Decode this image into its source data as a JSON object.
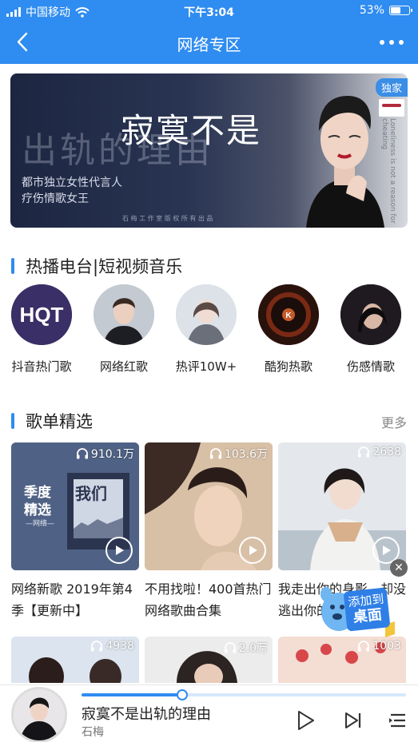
{
  "status_bar": {
    "carrier": "中国移动",
    "time": "下午3:04",
    "battery": "53%",
    "battery_level": 0.53
  },
  "header": {
    "title": "网络专区"
  },
  "banner": {
    "background_title": "出轨的理由",
    "title": "寂寞不是",
    "subtitle_1": "都市独立女性代言人",
    "subtitle_2": "疗伤情歌女王",
    "credit": "石 梅 工 作 室 版 权 所 有 出 品",
    "side_text": "Loneliness is not a reason for cheating",
    "badge": "独家"
  },
  "radio_section": {
    "title": "热播电台|短视频音乐",
    "items": [
      {
        "label": "抖音热门歌",
        "logo_text": "HQT"
      },
      {
        "label": "网络红歌"
      },
      {
        "label": "热评10W+"
      },
      {
        "label": "酷狗热歌",
        "logo_text": "K"
      },
      {
        "label": "伤感情歌"
      }
    ]
  },
  "playlist_section": {
    "title": "歌单精选",
    "more_label": "更多",
    "cards": [
      {
        "count": "910.1万",
        "name": "网络新歌 2019年第4季【更新中】",
        "cover_title_1": "季度",
        "cover_title_2": "精选",
        "cover_sub": "—网络—",
        "cover_script": "我们"
      },
      {
        "count": "103.6万",
        "name": "不用找啦！400首热门网络歌曲合集"
      },
      {
        "count": "2638",
        "name": "我走出你的身影，却没逃出你的心"
      },
      {
        "count": "4938"
      },
      {
        "count": "2.0万"
      },
      {
        "count": "1003"
      }
    ]
  },
  "float_widget": {
    "line1": "添加到",
    "line2": "桌面"
  },
  "player": {
    "song": "寂寞不是出轨的理由",
    "artist": "石梅",
    "progress": 0.31
  }
}
